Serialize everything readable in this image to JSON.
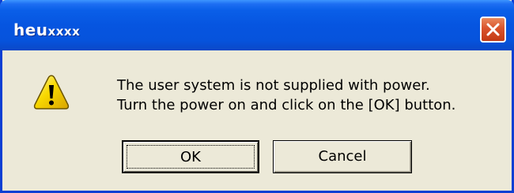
{
  "window": {
    "title": "heu",
    "title_suffix": "xxxx"
  },
  "dialog": {
    "icon": "warning-icon",
    "message_line1": "The user system is not supplied with power.",
    "message_line2": "Turn the power on and click on the [OK] button."
  },
  "buttons": {
    "ok_label": "OK",
    "cancel_label": "Cancel"
  },
  "colors": {
    "titlebar": "#0655e0",
    "close_button": "#d9532c",
    "dialog_background": "#ece9d8",
    "warning_yellow": "#f8d800"
  }
}
